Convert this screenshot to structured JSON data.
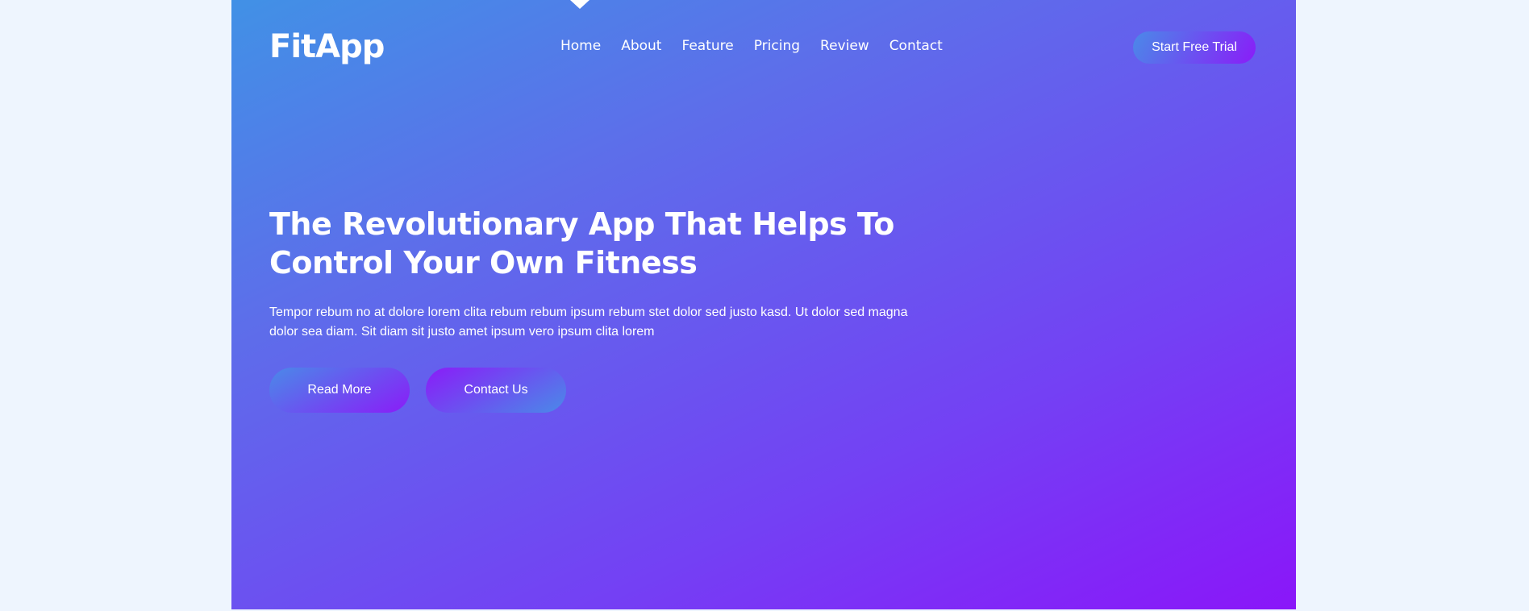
{
  "brand": {
    "name": "FitApp"
  },
  "nav": {
    "items": [
      {
        "label": "Home"
      },
      {
        "label": "About"
      },
      {
        "label": "Feature"
      },
      {
        "label": "Pricing"
      },
      {
        "label": "Review"
      },
      {
        "label": "Contact"
      }
    ],
    "active": "Home"
  },
  "header": {
    "cta_label": "Start Free Trial"
  },
  "hero": {
    "headline_line1": "The Revolutionary App That Helps To",
    "headline_line2": "Control Your Own Fitness",
    "lede": "Tempor rebum no at dolore lorem clita rebum rebum ipsum rebum stet dolor sed justo kasd. Ut dolor sed magna dolor sea diam. Sit diam sit justo amet ipsum vero ipsum clita lorem",
    "read_more_label": "Read More",
    "contact_label": "Contact Us"
  },
  "colors": {
    "page_background": "#eef5fe",
    "gradient_start": "#4191e6",
    "gradient_end": "#8a16f9",
    "text": "#ffffff"
  }
}
